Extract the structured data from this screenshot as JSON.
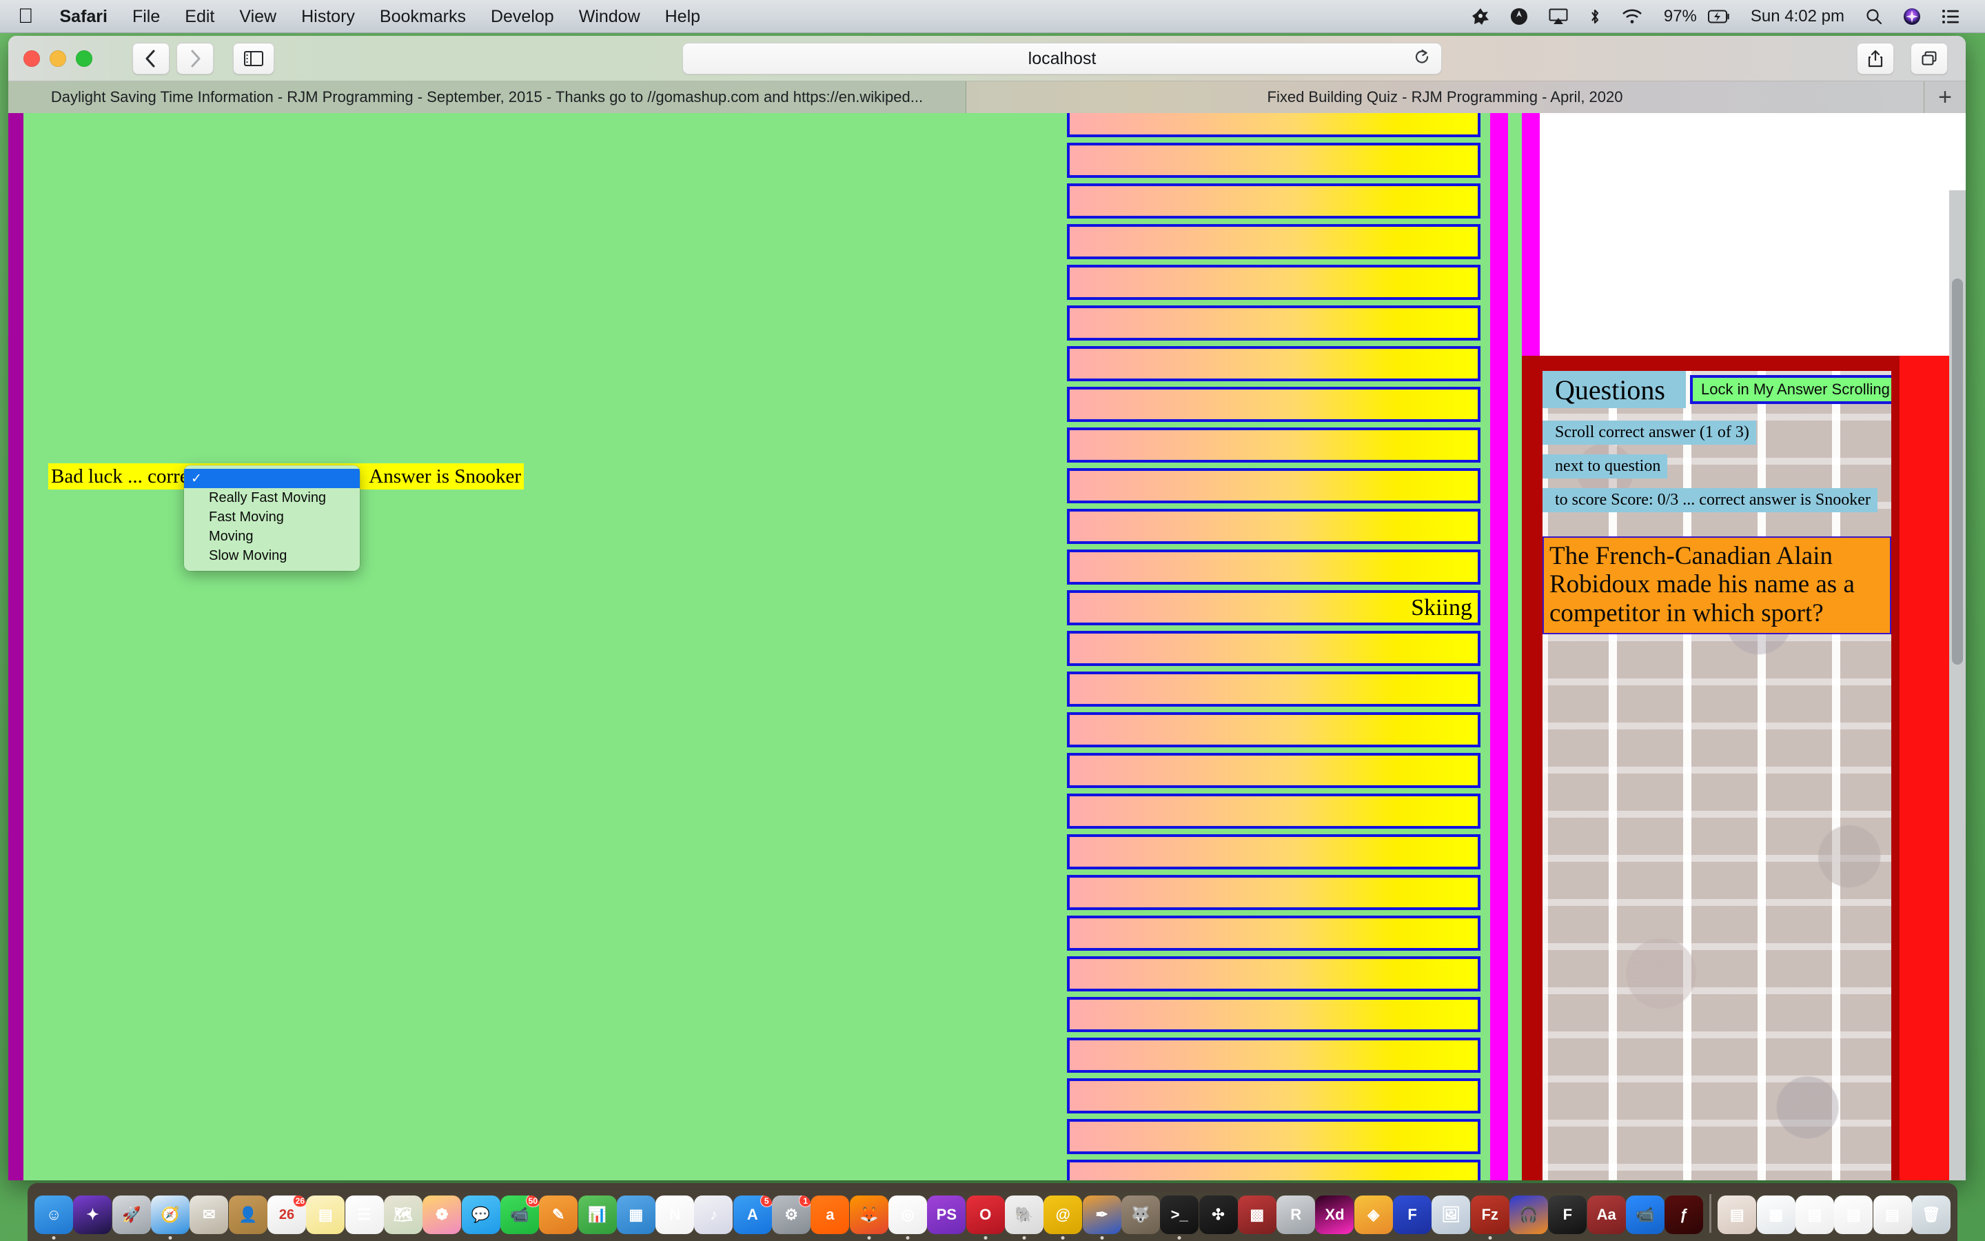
{
  "menubar": {
    "apple": "apple-logo",
    "items": [
      {
        "label": "Safari",
        "bold": true
      },
      {
        "label": "File",
        "bold": false
      },
      {
        "label": "Edit",
        "bold": false
      },
      {
        "label": "View",
        "bold": false
      },
      {
        "label": "History",
        "bold": false
      },
      {
        "label": "Bookmarks",
        "bold": false
      },
      {
        "label": "Develop",
        "bold": false
      },
      {
        "label": "Window",
        "bold": false
      },
      {
        "label": "Help",
        "bold": false
      }
    ],
    "status": {
      "battery_percent": "97%",
      "clock": "Sun 4:02 pm"
    }
  },
  "browser": {
    "url": "localhost",
    "tabs": [
      {
        "title": "Daylight Saving Time Information - RJM Programming - September, 2015 - Thanks go to //gomashup.com and https://en.wikiped...",
        "active": false
      },
      {
        "title": "Fixed Building Quiz - RJM Programming - April, 2020",
        "active": true
      }
    ],
    "new_tab_label": "+"
  },
  "left_page": {
    "banner_left": "Bad luck ... correct",
    "banner_right": "Answer is Snooker"
  },
  "select_popup": {
    "options": [
      {
        "label": "",
        "selected": true,
        "check": "✓"
      },
      {
        "label": "Really Fast Moving",
        "selected": false,
        "check": ""
      },
      {
        "label": "Fast Moving",
        "selected": false,
        "check": ""
      },
      {
        "label": "Moving",
        "selected": false,
        "check": ""
      },
      {
        "label": "Slow Moving",
        "selected": false,
        "check": ""
      }
    ]
  },
  "scroller": {
    "slots": [
      "",
      "",
      "",
      "",
      "",
      "",
      "",
      "",
      "",
      "",
      "",
      "",
      "Skiing",
      "",
      "",
      "",
      "",
      "",
      "",
      "",
      "",
      "",
      "",
      "",
      "",
      "",
      ""
    ]
  },
  "quiz_panel": {
    "title": "Questions",
    "lock_button": "Lock in My Answer Scrolling",
    "line1": "Scroll correct answer (1 of 3)",
    "line2": "next to question",
    "line3": "to score    Score: 0/3 ... correct answer is Snooker",
    "question": "The French-Canadian Alain Robidoux made his name as a competitor in which sport?"
  },
  "dock": {
    "items": [
      {
        "name": "finder",
        "badge": "",
        "running": true
      },
      {
        "name": "siri",
        "badge": "",
        "running": false
      },
      {
        "name": "launchpad",
        "badge": "",
        "running": false
      },
      {
        "name": "safari",
        "badge": "",
        "running": true
      },
      {
        "name": "mail",
        "badge": "",
        "running": false
      },
      {
        "name": "contacts",
        "badge": "",
        "running": false
      },
      {
        "name": "calendar",
        "badge": "26",
        "running": false
      },
      {
        "name": "notes",
        "badge": "",
        "running": false
      },
      {
        "name": "reminders",
        "badge": "",
        "running": false
      },
      {
        "name": "maps",
        "badge": "",
        "running": false
      },
      {
        "name": "photos",
        "badge": "",
        "running": false
      },
      {
        "name": "messages",
        "badge": "",
        "running": false
      },
      {
        "name": "facetime",
        "badge": "50",
        "running": false
      },
      {
        "name": "pages",
        "badge": "",
        "running": false
      },
      {
        "name": "numbers",
        "badge": "",
        "running": false
      },
      {
        "name": "keynote",
        "badge": "",
        "running": false
      },
      {
        "name": "news",
        "badge": "",
        "running": false
      },
      {
        "name": "itunes",
        "badge": "",
        "running": false
      },
      {
        "name": "appstore",
        "badge": "5",
        "running": false
      },
      {
        "name": "system-preferences",
        "badge": "1",
        "running": false
      },
      {
        "name": "avast",
        "badge": "",
        "running": false
      },
      {
        "name": "firefox",
        "badge": "",
        "running": true
      },
      {
        "name": "chrome",
        "badge": "",
        "running": true
      },
      {
        "name": "phpstorm",
        "badge": "",
        "running": false
      },
      {
        "name": "opera",
        "badge": "",
        "running": true
      },
      {
        "name": "evernote",
        "badge": "",
        "running": true
      },
      {
        "name": "wolfram",
        "badge": "",
        "running": true
      },
      {
        "name": "sketchbook",
        "badge": "",
        "running": true
      },
      {
        "name": "gimp",
        "badge": "",
        "running": false
      },
      {
        "name": "terminal",
        "badge": "",
        "running": true
      },
      {
        "name": "inkscape",
        "badge": "",
        "running": false
      },
      {
        "name": "photo-collage",
        "badge": "",
        "running": false
      },
      {
        "name": "rstudio",
        "badge": "",
        "running": false
      },
      {
        "name": "adobe-xd",
        "badge": "",
        "running": false
      },
      {
        "name": "sketch",
        "badge": "",
        "running": false
      },
      {
        "name": "figma",
        "badge": "",
        "running": false
      },
      {
        "name": "preview",
        "badge": "",
        "running": false
      },
      {
        "name": "filezilla",
        "badge": "",
        "running": true
      },
      {
        "name": "audacity",
        "badge": "",
        "running": false
      },
      {
        "name": "fontlab",
        "badge": "",
        "running": false
      },
      {
        "name": "dictionary",
        "badge": "",
        "running": false
      },
      {
        "name": "zoom",
        "badge": "",
        "running": false
      },
      {
        "name": "flash",
        "badge": "",
        "running": false
      },
      {
        "name": "brick-doc",
        "badge": "",
        "running": false
      },
      {
        "name": "spreadsheet-doc",
        "badge": "",
        "running": false
      },
      {
        "name": "chrome-doc-1",
        "badge": "",
        "running": false
      },
      {
        "name": "chrome-doc-2",
        "badge": "",
        "running": false
      },
      {
        "name": "editor-doc",
        "badge": "",
        "running": false
      },
      {
        "name": "trash",
        "badge": "",
        "running": false
      }
    ]
  }
}
